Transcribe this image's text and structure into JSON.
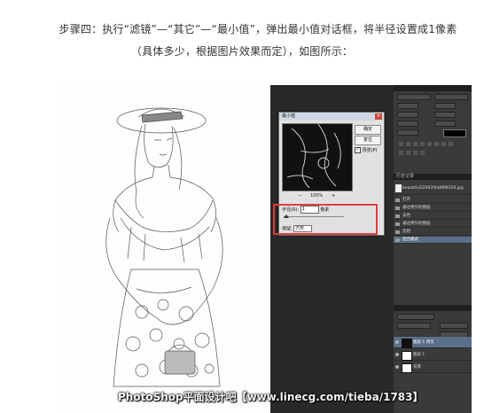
{
  "instructions": {
    "line1": "步骤四：执行“滤镜”—“其它”—“最小值”，弹出最小值对话框，将半径设置成1像素",
    "line2": "（具体多少，根据图片效果而定），如图所示："
  },
  "dialog": {
    "title": "最小值",
    "ok_label": "确定",
    "cancel_label": "复位",
    "preview_label": "预览(P)",
    "preview_checked": true,
    "zoom_level": "100%",
    "zoom_out_label": "−",
    "zoom_in_label": "+",
    "radius_label": "半径(R):",
    "radius_value": "1",
    "radius_unit": "像素",
    "keep_label": "保留:",
    "keep_value": "方形"
  },
  "panels": {
    "history_tab": "历史记录",
    "history_doc": "beautiful32092f4dd9f8320.jpg",
    "history_items": [
      "打开",
      "通过拷贝的图层",
      "去色",
      "通过拷贝的图层",
      "反相",
      "混合模式"
    ],
    "layers": [
      {
        "name": "图层 1 拷贝",
        "selected": true
      },
      {
        "name": "图层 1",
        "selected": false
      },
      {
        "name": "背景",
        "selected": false
      }
    ]
  },
  "watermark": "PhotoShop平面设计吧【www.linecg.com/tieba/1783】",
  "colors": {
    "highlight": "#e23c3c",
    "selection": "#5a6f88"
  }
}
